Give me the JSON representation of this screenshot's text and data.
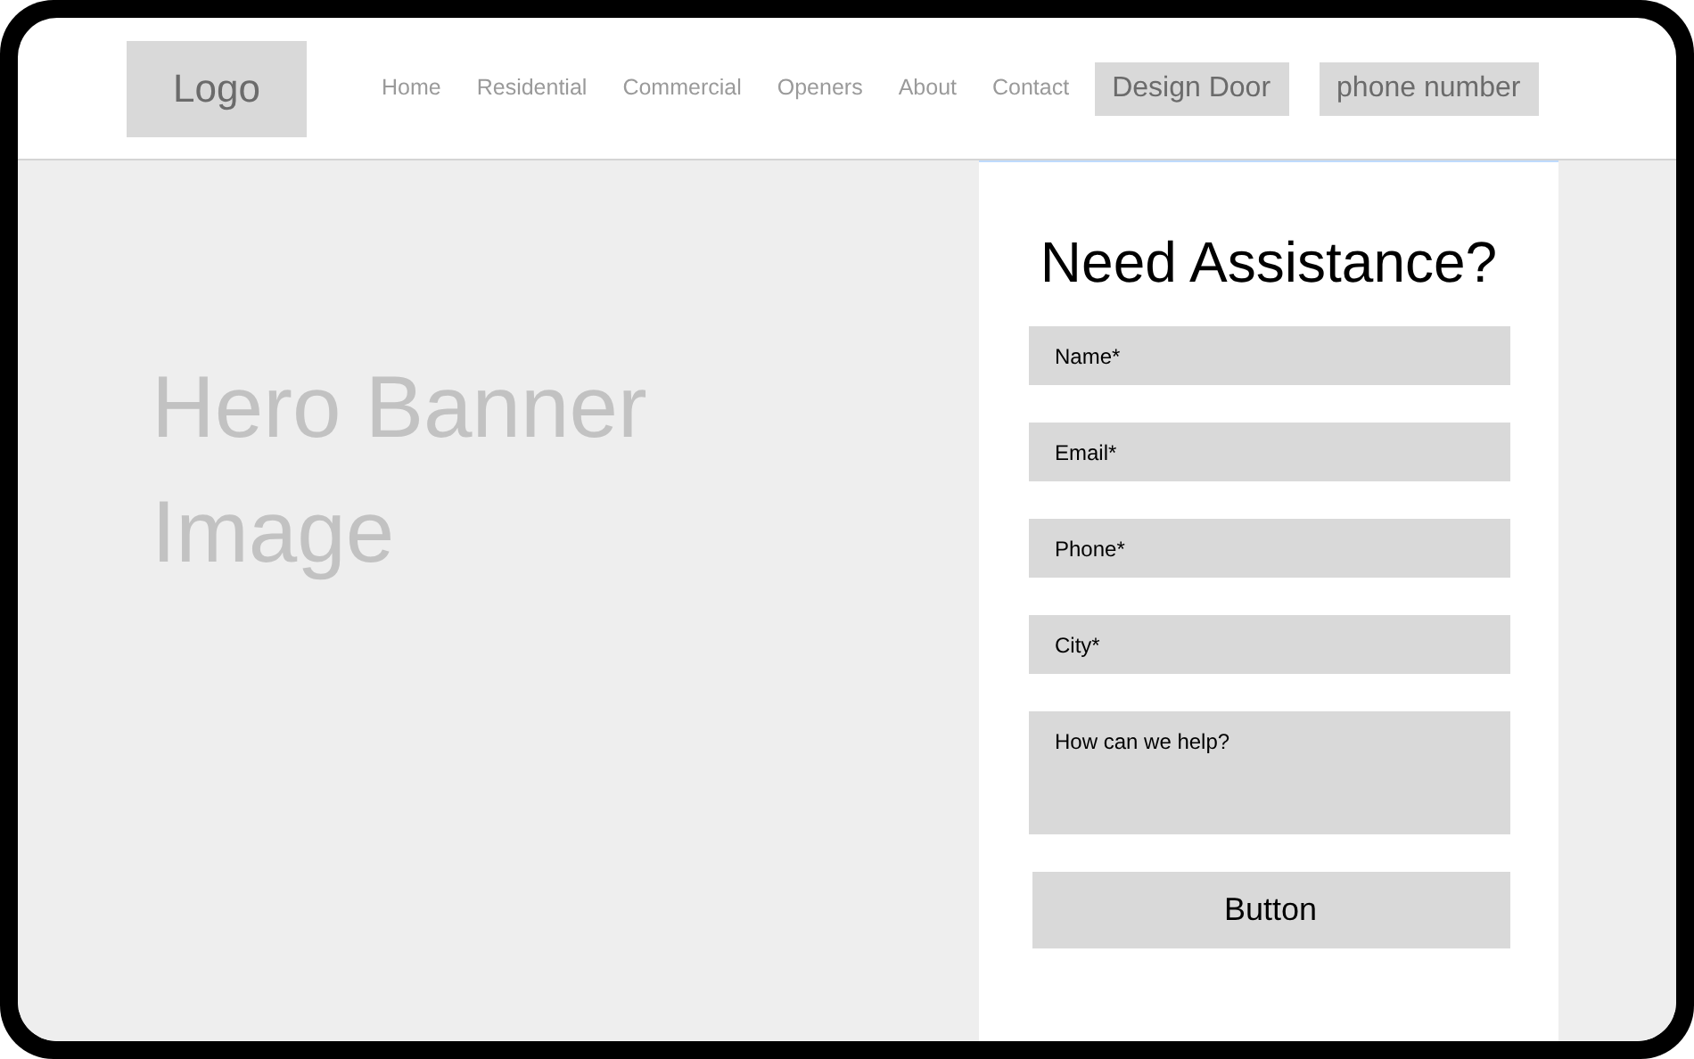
{
  "logo": "Logo",
  "nav": [
    {
      "label": "Home"
    },
    {
      "label": "Residential"
    },
    {
      "label": "Commercial"
    },
    {
      "label": "Openers"
    },
    {
      "label": "About"
    },
    {
      "label": "Contact"
    }
  ],
  "header_buttons": [
    "Design Door",
    "phone number"
  ],
  "hero": {
    "text": "Hero Banner Image"
  },
  "form": {
    "title": "Need Assistance?",
    "fields": [
      {
        "kind": "input",
        "placeholder": "Name*"
      },
      {
        "kind": "input",
        "placeholder": "Email*"
      },
      {
        "kind": "input",
        "placeholder": "Phone*"
      },
      {
        "kind": "input",
        "placeholder": "City*"
      },
      {
        "kind": "textarea",
        "placeholder": "How can we help?"
      }
    ],
    "button": "Button"
  }
}
